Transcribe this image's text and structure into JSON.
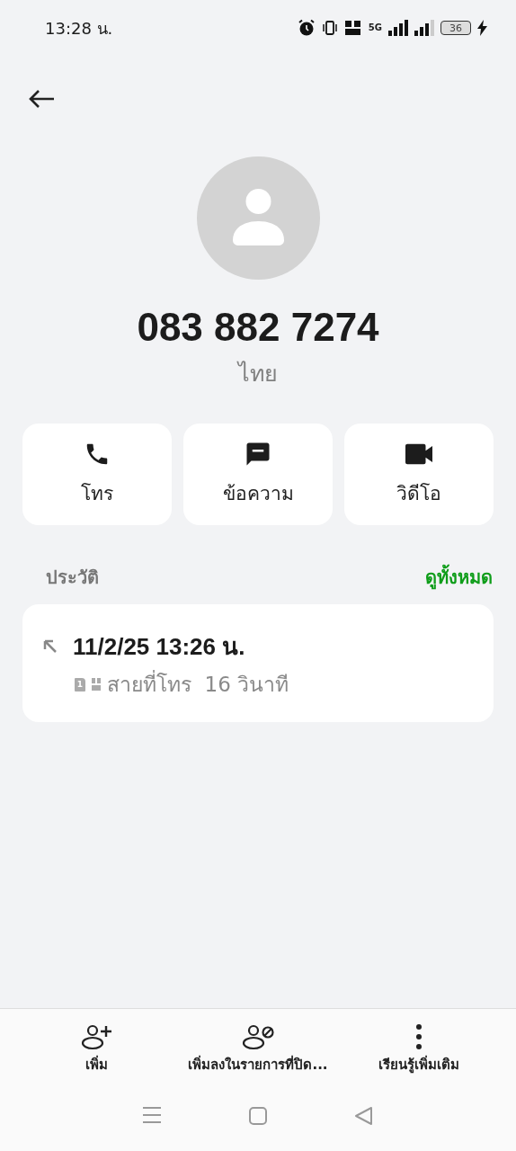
{
  "status_bar": {
    "time": "13:28 น.",
    "network": "5G",
    "battery": "36",
    "charging": true
  },
  "contact": {
    "number": "083 882 7274",
    "location": "ไทย"
  },
  "actions": [
    {
      "kind": "call",
      "label": "โทร"
    },
    {
      "kind": "message",
      "label": "ข้อความ"
    },
    {
      "kind": "video",
      "label": "วิดีโอ"
    }
  ],
  "history": {
    "title": "ประวัติ",
    "see_all": "ดูทั้งหมด",
    "entries": [
      {
        "kind": "outgoing",
        "datetime": "11/2/25 13:26 น.",
        "sim": "1",
        "detail": "สายที่โทร  16 วินาที"
      }
    ]
  },
  "bottom_actions": [
    {
      "kind": "add",
      "label": "เพิ่ม"
    },
    {
      "kind": "block",
      "label": "เพิ่มลงในรายการที่ปิด..."
    },
    {
      "kind": "more",
      "label": "เรียนรู้เพิ่มเติม"
    }
  ]
}
